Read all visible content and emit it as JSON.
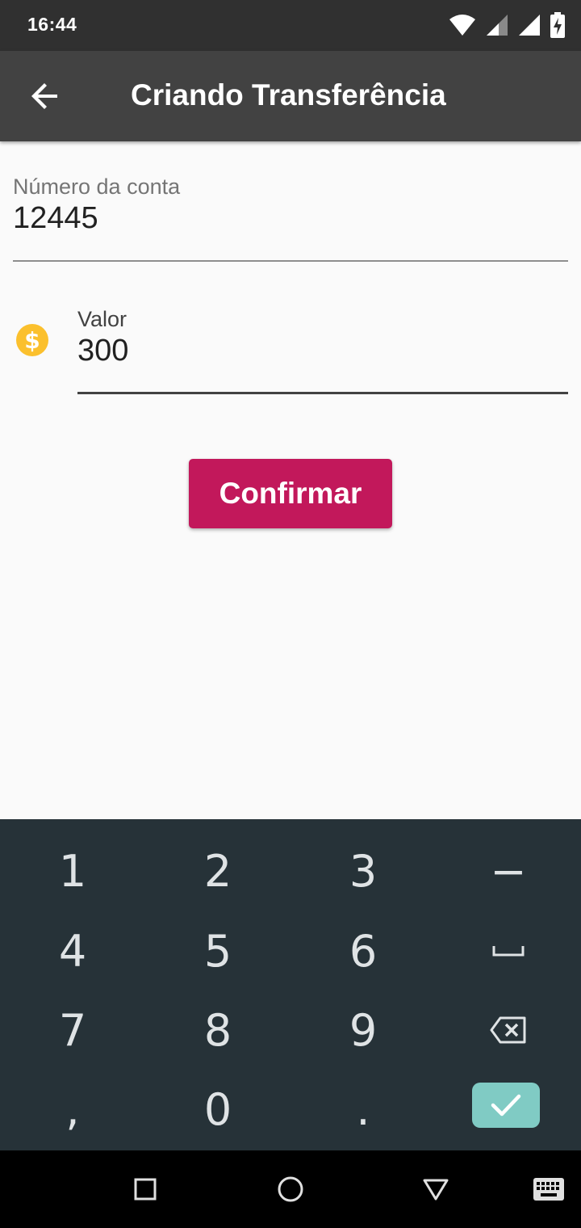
{
  "status_bar": {
    "time": "16:44",
    "icons": [
      "wifi-icon",
      "signal-icon",
      "signal-icon",
      "battery-charging-icon"
    ]
  },
  "app_bar": {
    "back_icon": "arrow-back-icon",
    "title": "Criando Transferência"
  },
  "form": {
    "account_number": {
      "label": "Número da conta",
      "value": "12445"
    },
    "amount": {
      "icon": "monetization-icon",
      "label": "Valor",
      "value": "300"
    },
    "confirm_label": "Confirmar"
  },
  "keyboard": {
    "rows": [
      [
        "1",
        "2",
        "3",
        "−"
      ],
      [
        "4",
        "5",
        "6",
        "␣"
      ],
      [
        "7",
        "8",
        "9",
        "backspace"
      ],
      [
        ",",
        "0",
        ".",
        "done"
      ]
    ],
    "special_icons": {
      "space": "space-icon",
      "backspace": "backspace-icon",
      "done": "check-icon"
    }
  },
  "nav_bar": {
    "buttons": [
      "recents-icon",
      "home-icon",
      "back-icon",
      "keyboard-icon"
    ]
  },
  "colors": {
    "status_bar": "#303030",
    "app_bar": "#424242",
    "accent_button": "#c2185b",
    "money_icon": "#fbc02d",
    "keyboard_bg": "#263238",
    "keyboard_enter": "#80cbc4"
  }
}
